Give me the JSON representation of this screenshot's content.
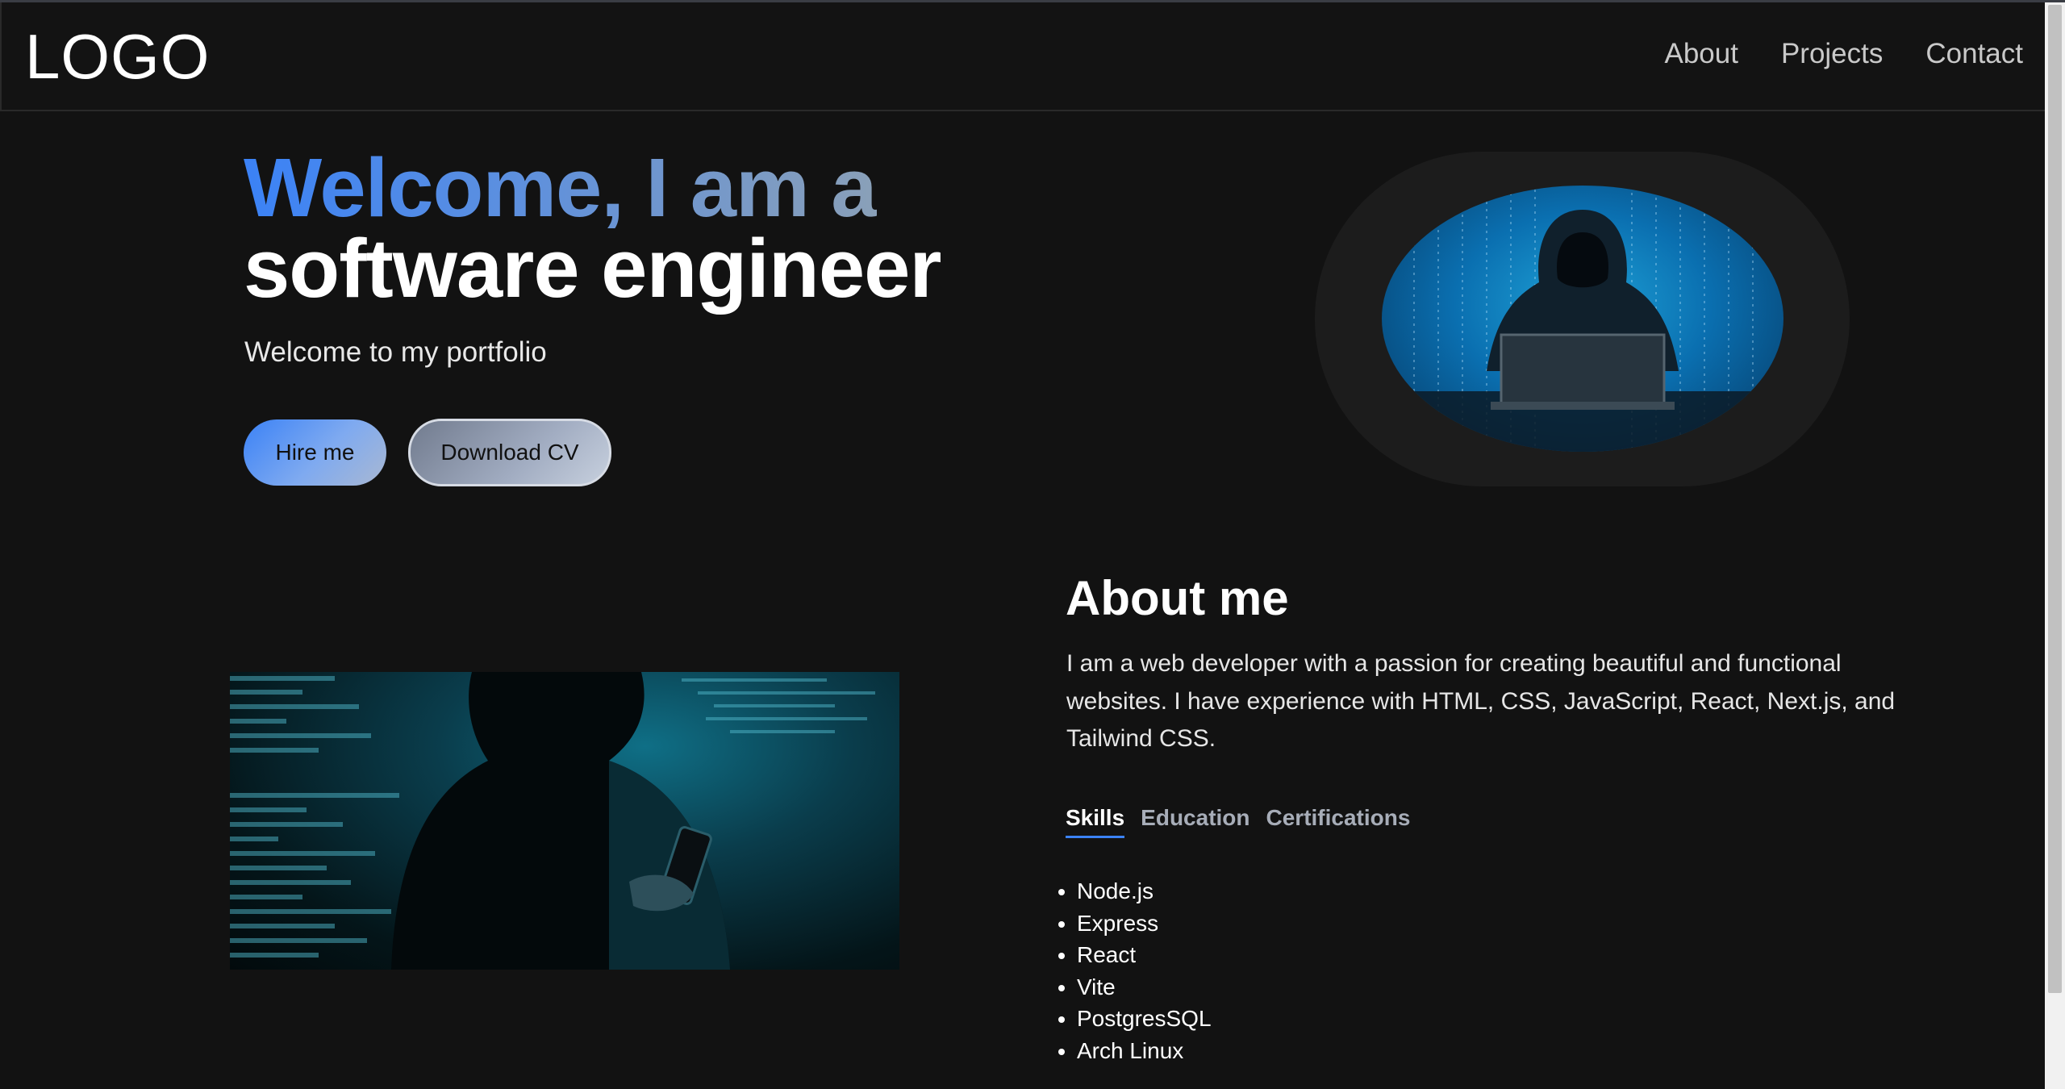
{
  "nav": {
    "logo": "LOGO",
    "links": [
      "About",
      "Projects",
      "Contact"
    ]
  },
  "hero": {
    "title_line1": "Welcome, I am a",
    "title_line2": "software engineer",
    "subtitle": "Welcome to my portfolio",
    "hire_label": "Hire me",
    "cv_label": "Download CV"
  },
  "about": {
    "title": "About me",
    "text": "I am a web developer with a passion for creating beautiful and functional websites. I have experience with HTML, CSS, JavaScript, React, Next.js, and Tailwind CSS.",
    "tabs": [
      "Skills",
      "Education",
      "Certifications"
    ],
    "active_tab": "Skills",
    "skills": [
      "Node.js",
      "Express",
      "React",
      "Vite",
      "PostgresSQL",
      "Arch Linux"
    ]
  },
  "colors": {
    "background": "#121212",
    "accent": "#3b82f6",
    "text": "#ffffff"
  }
}
